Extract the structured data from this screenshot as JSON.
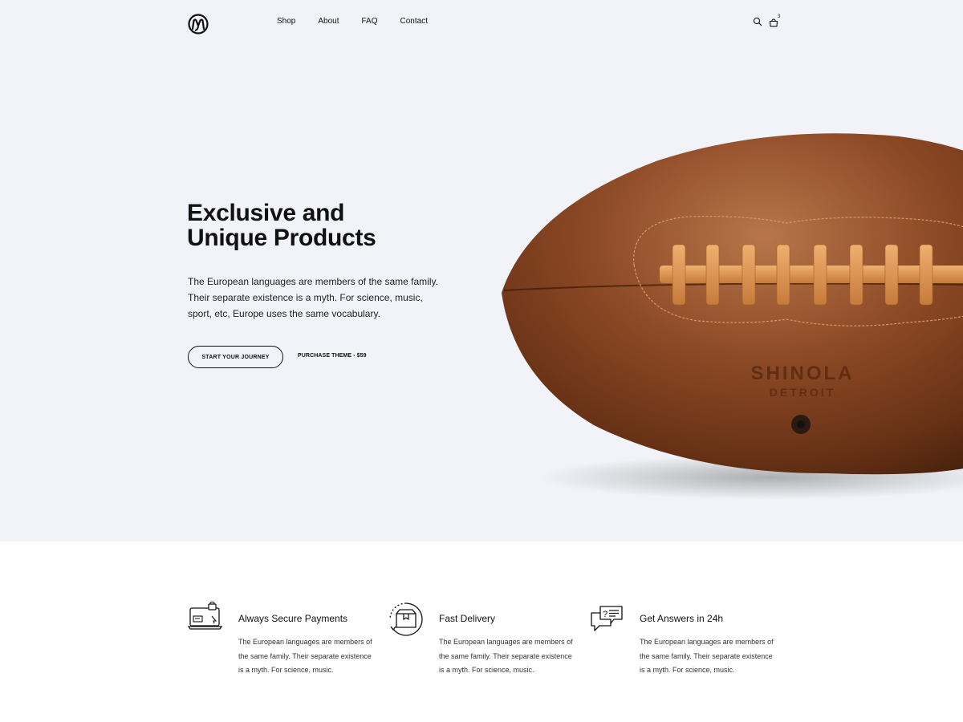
{
  "header": {
    "logo_icon": "monogram-logo",
    "nav": [
      "Shop",
      "About",
      "FAQ",
      "Contact"
    ],
    "search_icon": "search-icon",
    "cart_icon": "shopping-bag-icon",
    "cart_count": "3"
  },
  "hero": {
    "title_line1": "Exclusive and",
    "title_line2": "Unique Products",
    "text": "The European languages are members of the same family. Their separate existence is a myth. For science, music, sport, etc, Europe uses the same vocabulary.",
    "primary_button": "START YOUR JOURNEY",
    "secondary_link": "PURCHASE THEME - $59",
    "background_color": "#f2f3f8",
    "image": {
      "subject": "brown leather american football",
      "brand_line1": "SHINOLA",
      "brand_line2": "DETROIT"
    }
  },
  "features": [
    {
      "icon": "secure-payment-icon",
      "title": "Always Secure Payments",
      "text": "The European languages are members of the same family. Their separate existence is a myth. For science, music."
    },
    {
      "icon": "delivery-box-icon",
      "title": "Fast Delivery",
      "text": "The European languages are members of the same family. Their separate existence is a myth. For science, music."
    },
    {
      "icon": "chat-question-icon",
      "title": "Get Answers in 24h",
      "text": "The European languages are members of the same family. Their separate existence is a myth. For science, music."
    }
  ]
}
